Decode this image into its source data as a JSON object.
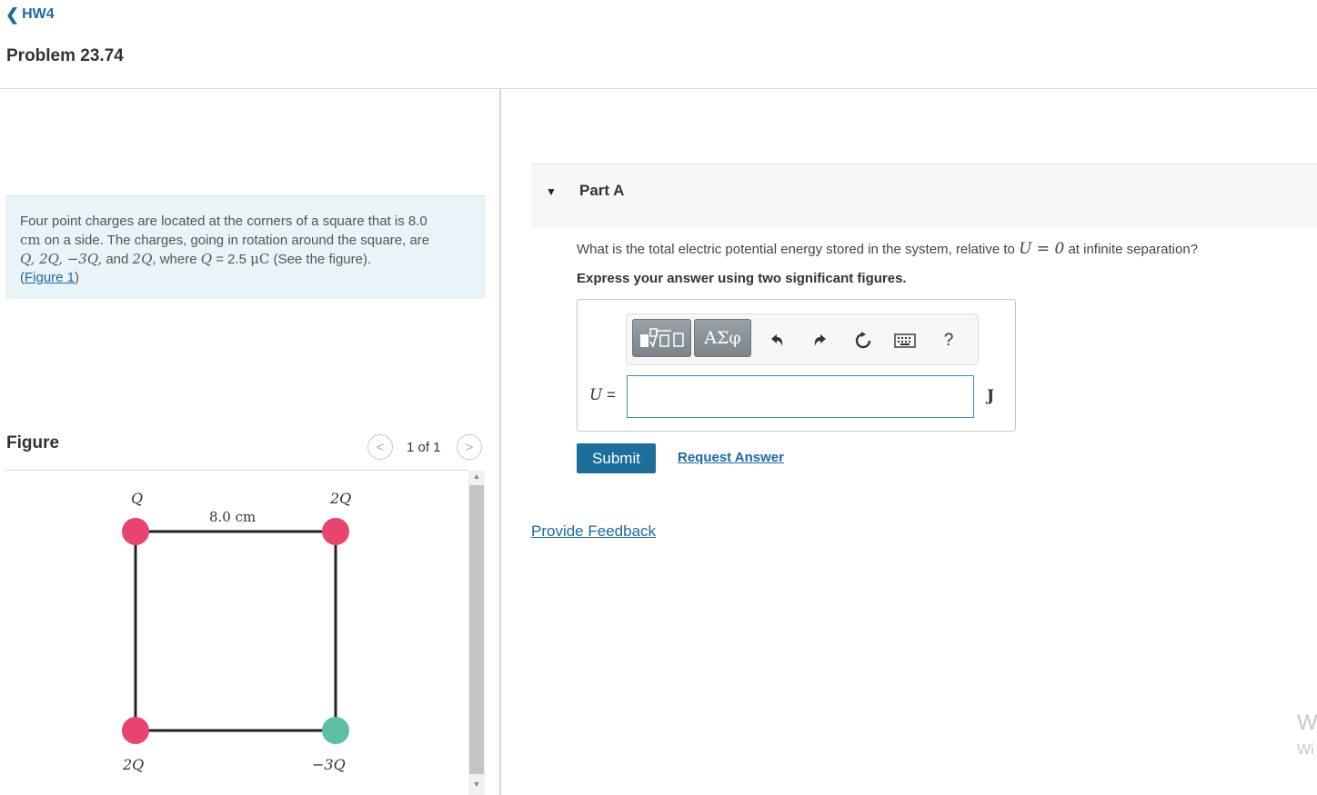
{
  "nav": {
    "back_label": "HW4"
  },
  "problem": {
    "title": "Problem 23.74",
    "text_1": "Four point charges are located at the corners of a square that is 8.0",
    "unit_cm": "cm",
    "text_2": " on a side. The charges, going in rotation around the square, are",
    "charges_list": "Q, 2Q, −3Q,",
    "text_and": " and ",
    "charge_last": "2Q",
    "text_where": ", where ",
    "charge_symbol": "Q",
    "charge_value": " = 2.5 ",
    "charge_unit": "μC",
    "text_see": " (See the figure).",
    "figure_link": "Figure 1"
  },
  "figure": {
    "label": "Figure",
    "pager_text": "1 of 1",
    "side_label": "8.0 cm",
    "charge_labels": {
      "top_left": "Q",
      "top_right": "2Q",
      "bottom_left": "2Q",
      "bottom_right": "−3Q"
    },
    "colors": {
      "positive": "#e9446f",
      "negative": "#5bc0a4",
      "edge": "#222222"
    }
  },
  "part_a": {
    "title": "Part A",
    "question_prefix": "What is the total electric potential energy stored in the system, relative to ",
    "question_math": "U = 0",
    "question_suffix": " at infinite separation?",
    "instruction": "Express your answer using two significant figures.",
    "toolbar": {
      "templates_icon": "templates-icon",
      "symbols_label": "ΑΣφ",
      "undo_icon": "undo-icon",
      "redo_icon": "redo-icon",
      "reset_icon": "reset-icon",
      "keyboard_icon": "keyboard-icon",
      "help_label": "?"
    },
    "answer_label": "U",
    "answer_equals": " =",
    "answer_value": "",
    "unit": "J",
    "submit_label": "Submit",
    "request_label": "Request Answer"
  },
  "feedback_label": "Provide Feedback",
  "watermark": {
    "line1": "W",
    "line2": "Wi"
  },
  "colors": {
    "accent": "#1b6f9a",
    "link": "#1a6aa8",
    "problem_bg": "#e8f4f8"
  }
}
